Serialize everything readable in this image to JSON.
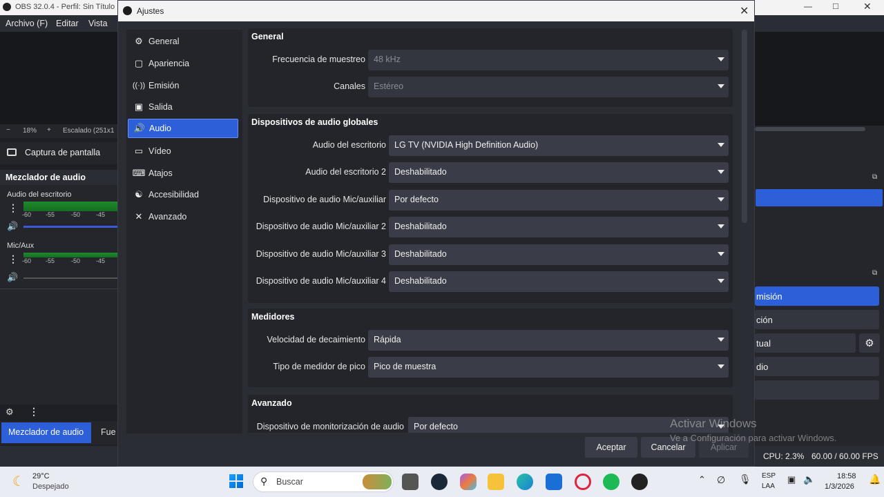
{
  "obs": {
    "title": "OBS 32.0.4 - Perfil: Sin Título",
    "menu": [
      "Archivo (F)",
      "Editar",
      "Vista"
    ],
    "zoom": "18%",
    "zoom_mode": "Escalado (251x1",
    "source": "Captura de pantalla",
    "mixer_title": "Mezclador de audio",
    "tracks": [
      {
        "name": "Audio del escritorio",
        "scale": [
          "-60",
          "-55",
          "-50",
          "-45"
        ]
      },
      {
        "name": "Mic/Aux",
        "scale": [
          "-60",
          "-55",
          "-50",
          "-45"
        ]
      }
    ],
    "bottom_tabs": [
      "Mezclador de audio",
      "Fue"
    ],
    "right_controls": [
      "misión",
      "ción",
      "tual",
      "dio"
    ],
    "status": {
      "cpu": "CPU: 2.3%",
      "fps": "60.00 / 60.00 FPS"
    }
  },
  "dialog": {
    "title": "Ajustes",
    "nav": [
      {
        "label": "General",
        "icon": "gear-icon"
      },
      {
        "label": "Apariencia",
        "icon": "appearance-icon"
      },
      {
        "label": "Emisión",
        "icon": "antenna-icon"
      },
      {
        "label": "Salida",
        "icon": "output-icon"
      },
      {
        "label": "Audio",
        "icon": "speaker-icon",
        "active": true
      },
      {
        "label": "Vídeo",
        "icon": "monitor-icon"
      },
      {
        "label": "Atajos",
        "icon": "keyboard-icon"
      },
      {
        "label": "Accesibilidad",
        "icon": "accessibility-icon"
      },
      {
        "label": "Avanzado",
        "icon": "tools-icon"
      }
    ],
    "general": {
      "title": "General",
      "sample_rate_label": "Frecuencia de muestreo",
      "sample_rate_value": "48 kHz",
      "channels_label": "Canales",
      "channels_value": "Estéreo"
    },
    "global_devices": {
      "title": "Dispositivos de audio globales",
      "rows": [
        {
          "label": "Audio del escritorio",
          "value": "LG TV (NVIDIA High Definition Audio)"
        },
        {
          "label": "Audio del escritorio 2",
          "value": "Deshabilitado"
        },
        {
          "label": "Dispositivo de audio Mic/auxiliar",
          "value": "Por defecto"
        },
        {
          "label": "Dispositivo de audio Mic/auxiliar 2",
          "value": "Deshabilitado"
        },
        {
          "label": "Dispositivo de audio Mic/auxiliar 3",
          "value": "Deshabilitado"
        },
        {
          "label": "Dispositivo de audio Mic/auxiliar 4",
          "value": "Deshabilitado"
        }
      ]
    },
    "meters": {
      "title": "Medidores",
      "decay_label": "Velocidad de decaimiento",
      "decay_value": "Rápida",
      "peak_label": "Tipo de medidor de pico",
      "peak_value": "Pico de muestra"
    },
    "advanced": {
      "title": "Avanzado",
      "monitor_label": "Dispositivo de monitorización de audio",
      "monitor_value": "Por defecto"
    },
    "buttons": {
      "accept": "Aceptar",
      "cancel": "Cancelar",
      "apply": "Aplicar"
    }
  },
  "watermark": {
    "line1": "Activar Windows",
    "line2": "Ve a Configuración para activar Windows."
  },
  "taskbar": {
    "weather_temp": "29°C",
    "weather_desc": "Despejado",
    "search_placeholder": "Buscar",
    "lang1": "ESP",
    "lang2": "LAA",
    "time": "18:58",
    "date": "1/3/2026"
  }
}
